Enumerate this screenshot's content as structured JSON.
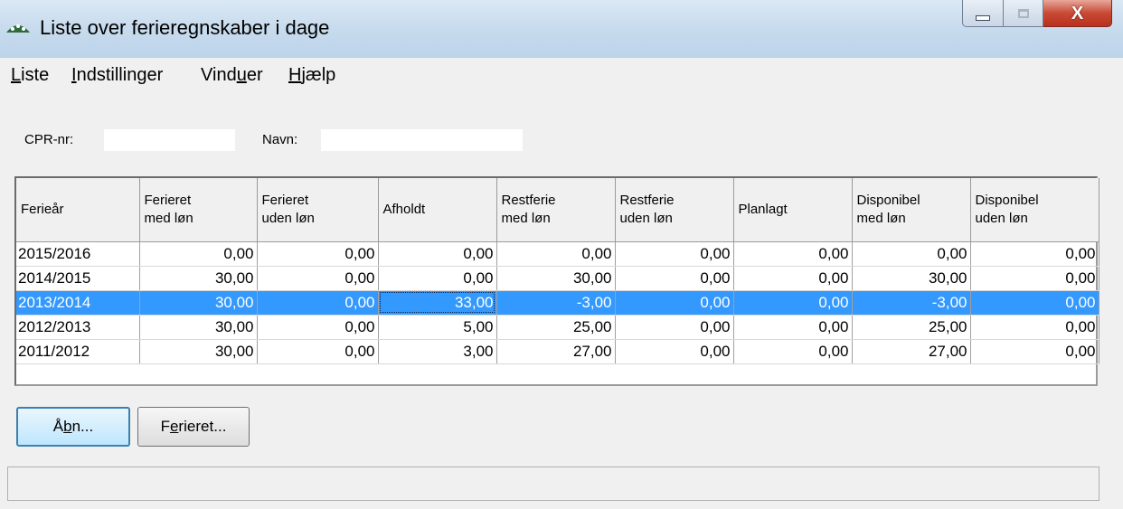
{
  "window": {
    "title": "Liste over ferieregnskaber i dage",
    "close_glyph": "X"
  },
  "menu": [
    {
      "label": "Liste",
      "mnemonic": 0
    },
    {
      "label": "Indstillinger",
      "mnemonic": 0
    },
    {
      "label": "Vinduer",
      "mnemonic": 4
    },
    {
      "label": "Hjælp",
      "mnemonic": 0
    }
  ],
  "info": {
    "cpr_label": "CPR-nr:",
    "cpr_value": "",
    "name_label": "Navn:",
    "name_value": ""
  },
  "table": {
    "columns": [
      "Ferieår",
      "Ferieret\nmed løn",
      "Ferieret\nuden løn",
      "Afholdt",
      "Restferie\nmed løn",
      "Restferie\nuden løn",
      "Planlagt",
      "Disponibel\nmed løn",
      "Disponibel\nuden løn"
    ],
    "rows": [
      [
        "2015/2016",
        "0,00",
        "0,00",
        "0,00",
        "0,00",
        "0,00",
        "0,00",
        "0,00",
        "0,00"
      ],
      [
        "2014/2015",
        "30,00",
        "0,00",
        "0,00",
        "30,00",
        "0,00",
        "0,00",
        "30,00",
        "0,00"
      ],
      [
        "2013/2014",
        "30,00",
        "0,00",
        "33,00",
        "-3,00",
        "0,00",
        "0,00",
        "-3,00",
        "0,00"
      ],
      [
        "2012/2013",
        "30,00",
        "0,00",
        "5,00",
        "25,00",
        "0,00",
        "0,00",
        "25,00",
        "0,00"
      ],
      [
        "2011/2012",
        "30,00",
        "0,00",
        "3,00",
        "27,00",
        "0,00",
        "0,00",
        "27,00",
        "0,00"
      ]
    ],
    "selected_row": 2
  },
  "buttons": {
    "open_label": "Åbn...",
    "open_mnemonic": 1,
    "vacation_label": "Ferieret...",
    "vacation_mnemonic": 1
  },
  "statusbar": {
    "text": ""
  },
  "colors": {
    "selection": "#3399ff",
    "background": "#f0f0f0"
  }
}
